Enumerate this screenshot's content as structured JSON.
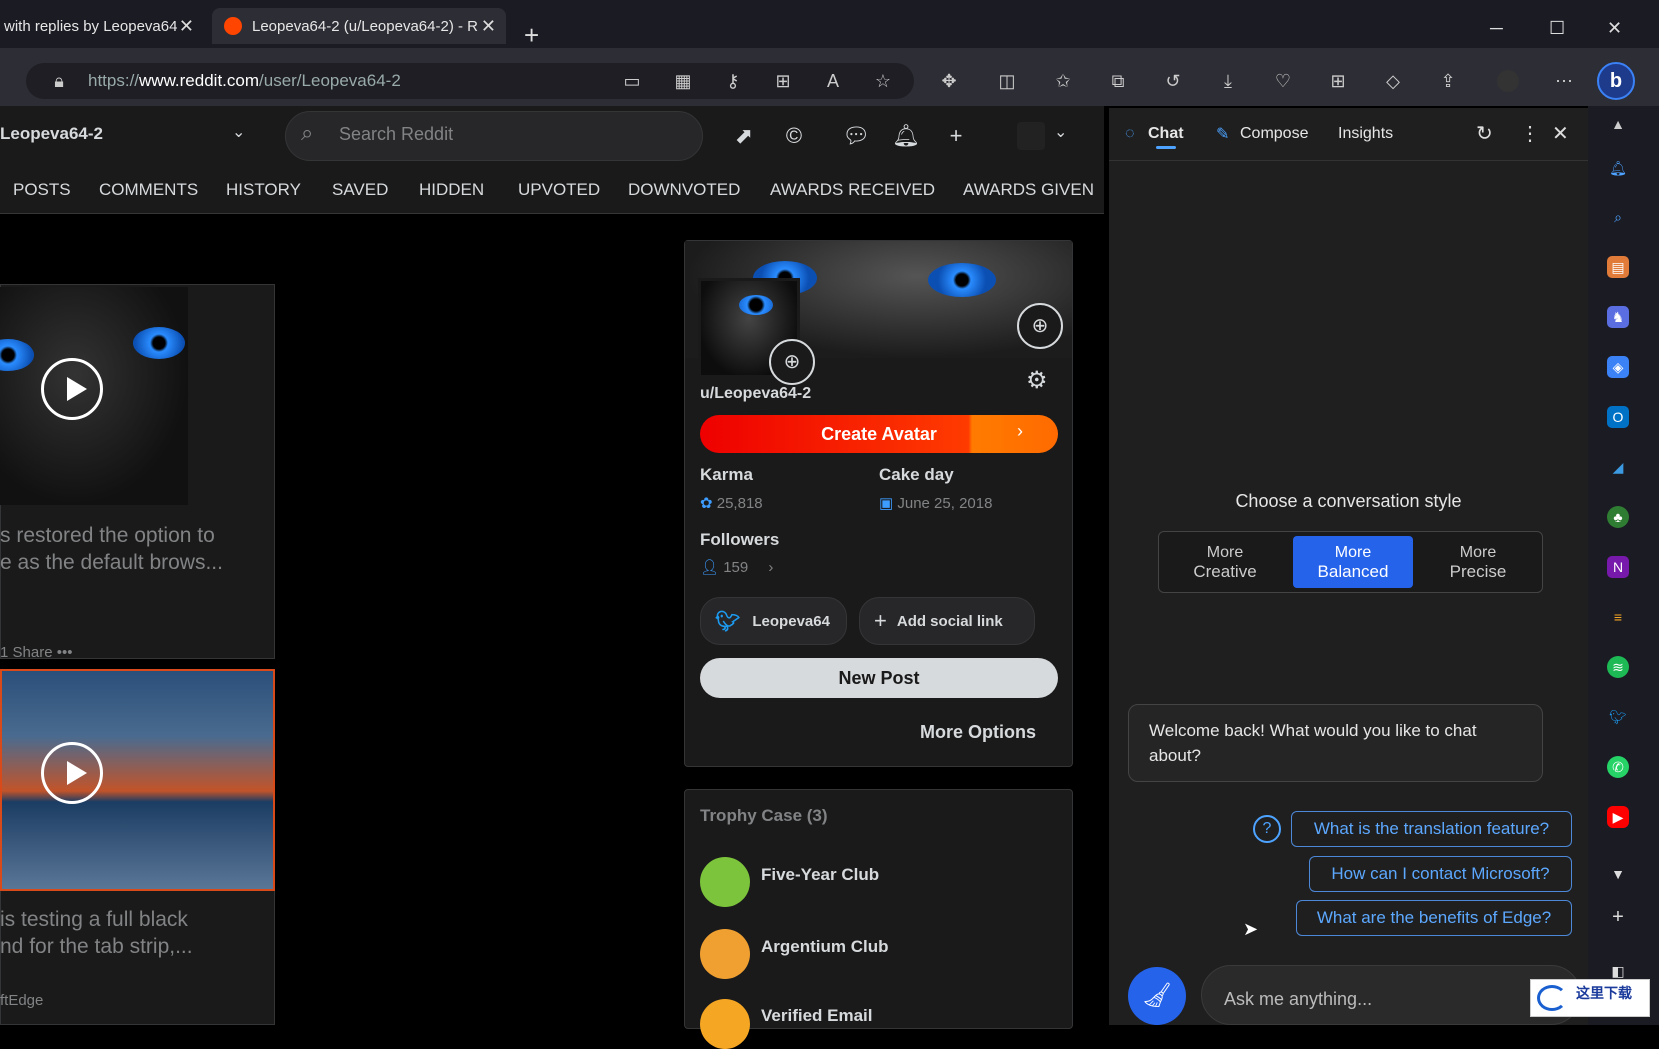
{
  "browser": {
    "tabs": [
      {
        "title": "with replies by Leopeva64",
        "active": false
      },
      {
        "title": "Leopeva64-2 (u/Leopeva64-2) - R",
        "active": true
      }
    ],
    "new_tab": "+",
    "url_prefix": "https://",
    "url_domain": "www.reddit.com",
    "url_path": "/user/Leopeva64-2",
    "win_min": "─",
    "win_max": "☐",
    "win_close": "✕",
    "tab_close": "✕"
  },
  "reddit": {
    "username_header": "Leopeva64-2",
    "search_placeholder": "Search Reddit",
    "profile_tabs": [
      "POSTS",
      "COMMENTS",
      "HISTORY",
      "SAVED",
      "HIDDEN",
      "UPVOTED",
      "DOWNVOTED",
      "AWARDS RECEIVED",
      "AWARDS GIVEN"
    ],
    "posts": [
      {
        "title_line1": "s restored the option to",
        "title_line2": "e as the default brows...",
        "footer": "1   Share   •••"
      },
      {
        "title_line1": "is testing a full black",
        "title_line2": "nd for the tab strip,...",
        "footer": "ftEdge"
      }
    ],
    "profile": {
      "handle": "u/Leopeva64-2",
      "create_avatar": "Create Avatar",
      "karma_label": "Karma",
      "karma_value": "25,818",
      "cakeday_label": "Cake day",
      "cakeday_value": "June 25, 2018",
      "followers_label": "Followers",
      "followers_value": "159",
      "twitter_label": "Leopeva64",
      "add_social": "Add social link",
      "new_post": "New Post",
      "more_options": "More Options"
    },
    "trophy_case": {
      "title": "Trophy Case (3)",
      "items": [
        "Five-Year Club",
        "Argentium Club",
        "Verified Email"
      ]
    }
  },
  "sidebar": {
    "tabs": {
      "chat": "Chat",
      "compose": "Compose",
      "insights": "Insights"
    },
    "conversation_title": "Choose a conversation style",
    "styles": [
      {
        "line1": "More",
        "line2": "Creative",
        "selected": false
      },
      {
        "line1": "More",
        "line2": "Balanced",
        "selected": true
      },
      {
        "line1": "More",
        "line2": "Precise",
        "selected": false
      }
    ],
    "welcome": "Welcome back! What would you like to chat about?",
    "suggestions": [
      "What is the translation feature?",
      "How can I contact Microsoft?",
      "What are the benefits of Edge?"
    ],
    "input_placeholder": "Ask me anything...",
    "accent_color": "#2563eb"
  },
  "watermark": {
    "text": "这里下载"
  }
}
